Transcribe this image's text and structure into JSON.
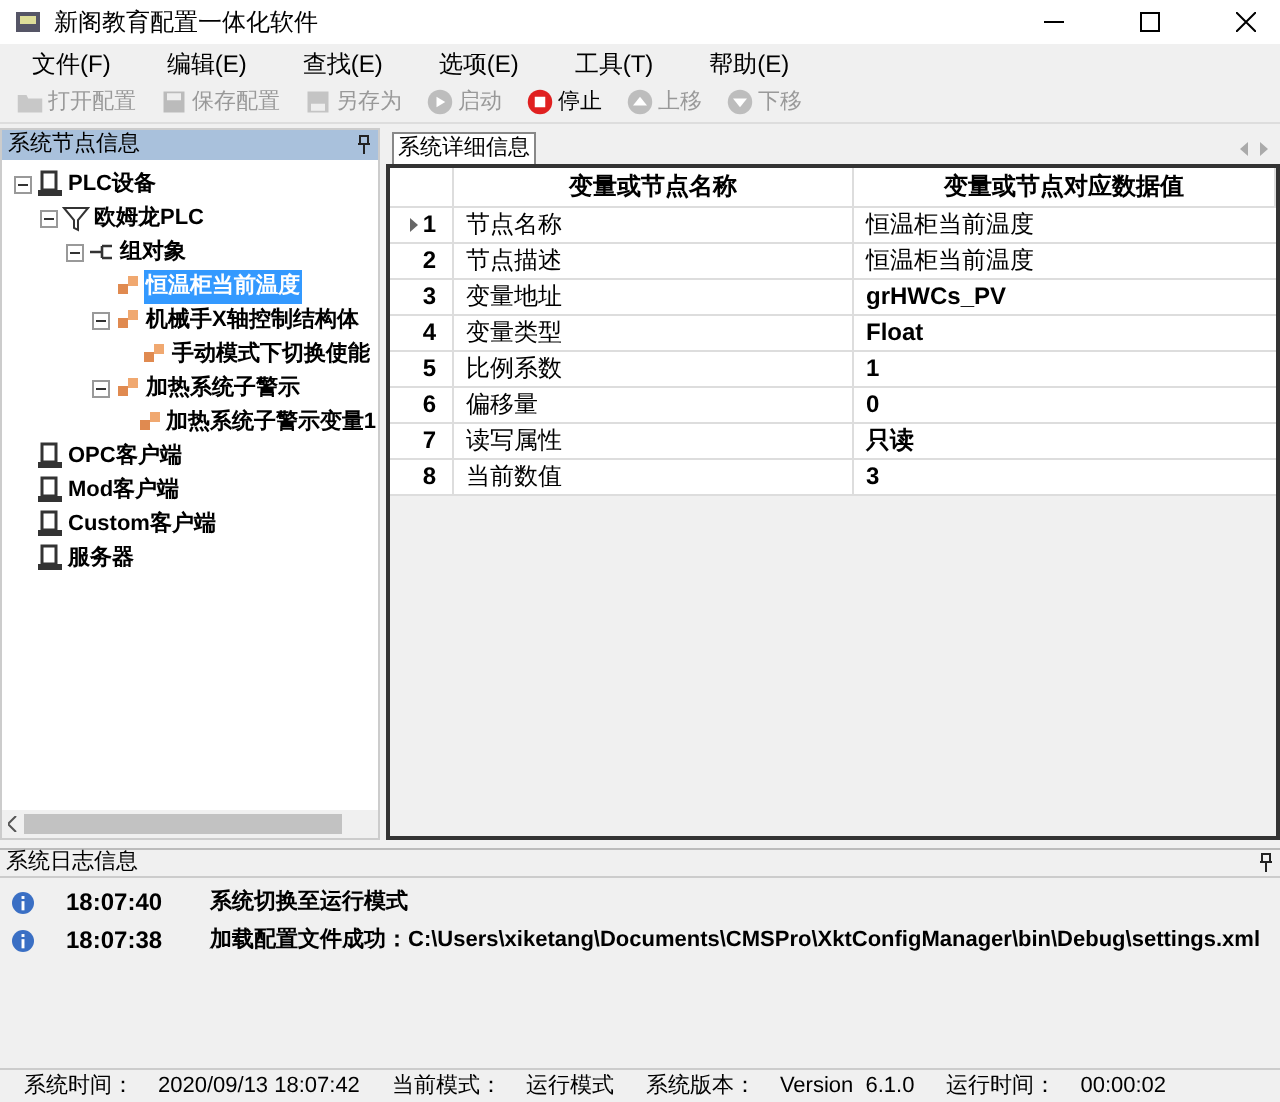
{
  "window": {
    "title": "新阁教育配置一体化软件"
  },
  "menu": [
    "文件(F)",
    "编辑(E)",
    "查找(E)",
    "选项(E)",
    "工具(T)",
    "帮助(E)"
  ],
  "toolbar": [
    {
      "label": "打开配置",
      "kind": "folder",
      "disabled": true
    },
    {
      "label": "保存配置",
      "kind": "save",
      "disabled": true
    },
    {
      "label": "另存为",
      "kind": "saveas",
      "disabled": true
    },
    {
      "label": "启动",
      "kind": "play",
      "disabled": true
    },
    {
      "label": "停止",
      "kind": "stop",
      "disabled": false
    },
    {
      "label": "上移",
      "kind": "up",
      "disabled": true
    },
    {
      "label": "下移",
      "kind": "down",
      "disabled": true
    }
  ],
  "node_panel": {
    "title": "系统节点信息",
    "tree": [
      {
        "label": "PLC设备",
        "kind": "device",
        "selected": false,
        "expanded": true,
        "children": [
          {
            "label": "欧姆龙PLC",
            "kind": "filter",
            "selected": false,
            "expanded": true,
            "children": [
              {
                "label": "组对象",
                "kind": "group",
                "selected": false,
                "expanded": true,
                "children": [
                  {
                    "label": "恒温柜当前温度",
                    "kind": "variable",
                    "selected": true
                  },
                  {
                    "label": "机械手X轴控制结构体",
                    "kind": "variable",
                    "selected": false,
                    "expanded": true,
                    "children": [
                      {
                        "label": "手动模式下切换使能",
                        "kind": "variable",
                        "selected": false
                      }
                    ]
                  },
                  {
                    "label": "加热系统子警示",
                    "kind": "variable",
                    "selected": false,
                    "expanded": true,
                    "children": [
                      {
                        "label": "加热系统子警示变量1",
                        "kind": "variable",
                        "selected": false
                      }
                    ]
                  }
                ]
              }
            ]
          }
        ]
      },
      {
        "label": "OPC客户端",
        "kind": "device",
        "selected": false
      },
      {
        "label": "Mod客户端",
        "kind": "device",
        "selected": false
      },
      {
        "label": "Custom客户端",
        "kind": "device",
        "selected": false
      },
      {
        "label": "服务器",
        "kind": "device",
        "selected": false
      }
    ]
  },
  "detail_panel": {
    "tab": "系统详细信息",
    "columns": [
      "变量或节点名称",
      "变量或节点对应数据值"
    ],
    "rows": [
      {
        "index": "1",
        "name": "节点名称",
        "value": "恒温柜当前温度",
        "bold": false,
        "selected": true
      },
      {
        "index": "2",
        "name": "节点描述",
        "value": "恒温柜当前温度",
        "bold": false,
        "selected": false
      },
      {
        "index": "3",
        "name": "变量地址",
        "value": "grHWCs_PV",
        "bold": true,
        "selected": false
      },
      {
        "index": "4",
        "name": "变量类型",
        "value": "Float",
        "bold": true,
        "selected": false
      },
      {
        "index": "5",
        "name": "比例系数",
        "value": "1",
        "bold": true,
        "selected": false
      },
      {
        "index": "6",
        "name": "偏移量",
        "value": "0",
        "bold": true,
        "selected": false
      },
      {
        "index": "7",
        "name": "读写属性",
        "value": "只读",
        "bold": true,
        "selected": false
      },
      {
        "index": "8",
        "name": "当前数值",
        "value": "3",
        "bold": true,
        "selected": false
      }
    ]
  },
  "log_panel": {
    "title": "系统日志信息",
    "entries": [
      {
        "time": "18:07:40",
        "message": "系统切换至运行模式"
      },
      {
        "time": "18:07:38",
        "message": "加载配置文件成功：C:\\Users\\xiketang\\Documents\\CMSPro\\XktConfigManager\\bin\\Debug\\settings.xml"
      }
    ]
  },
  "status_bar": [
    {
      "label": "系统时间：",
      "value": "2020/09/13 18:07:42"
    },
    {
      "label": "当前模式：",
      "value": "运行模式"
    },
    {
      "label": "系统版本：",
      "value": "Version  6.1.0"
    },
    {
      "label": "运行时间：",
      "value": "00:00:02"
    }
  ]
}
